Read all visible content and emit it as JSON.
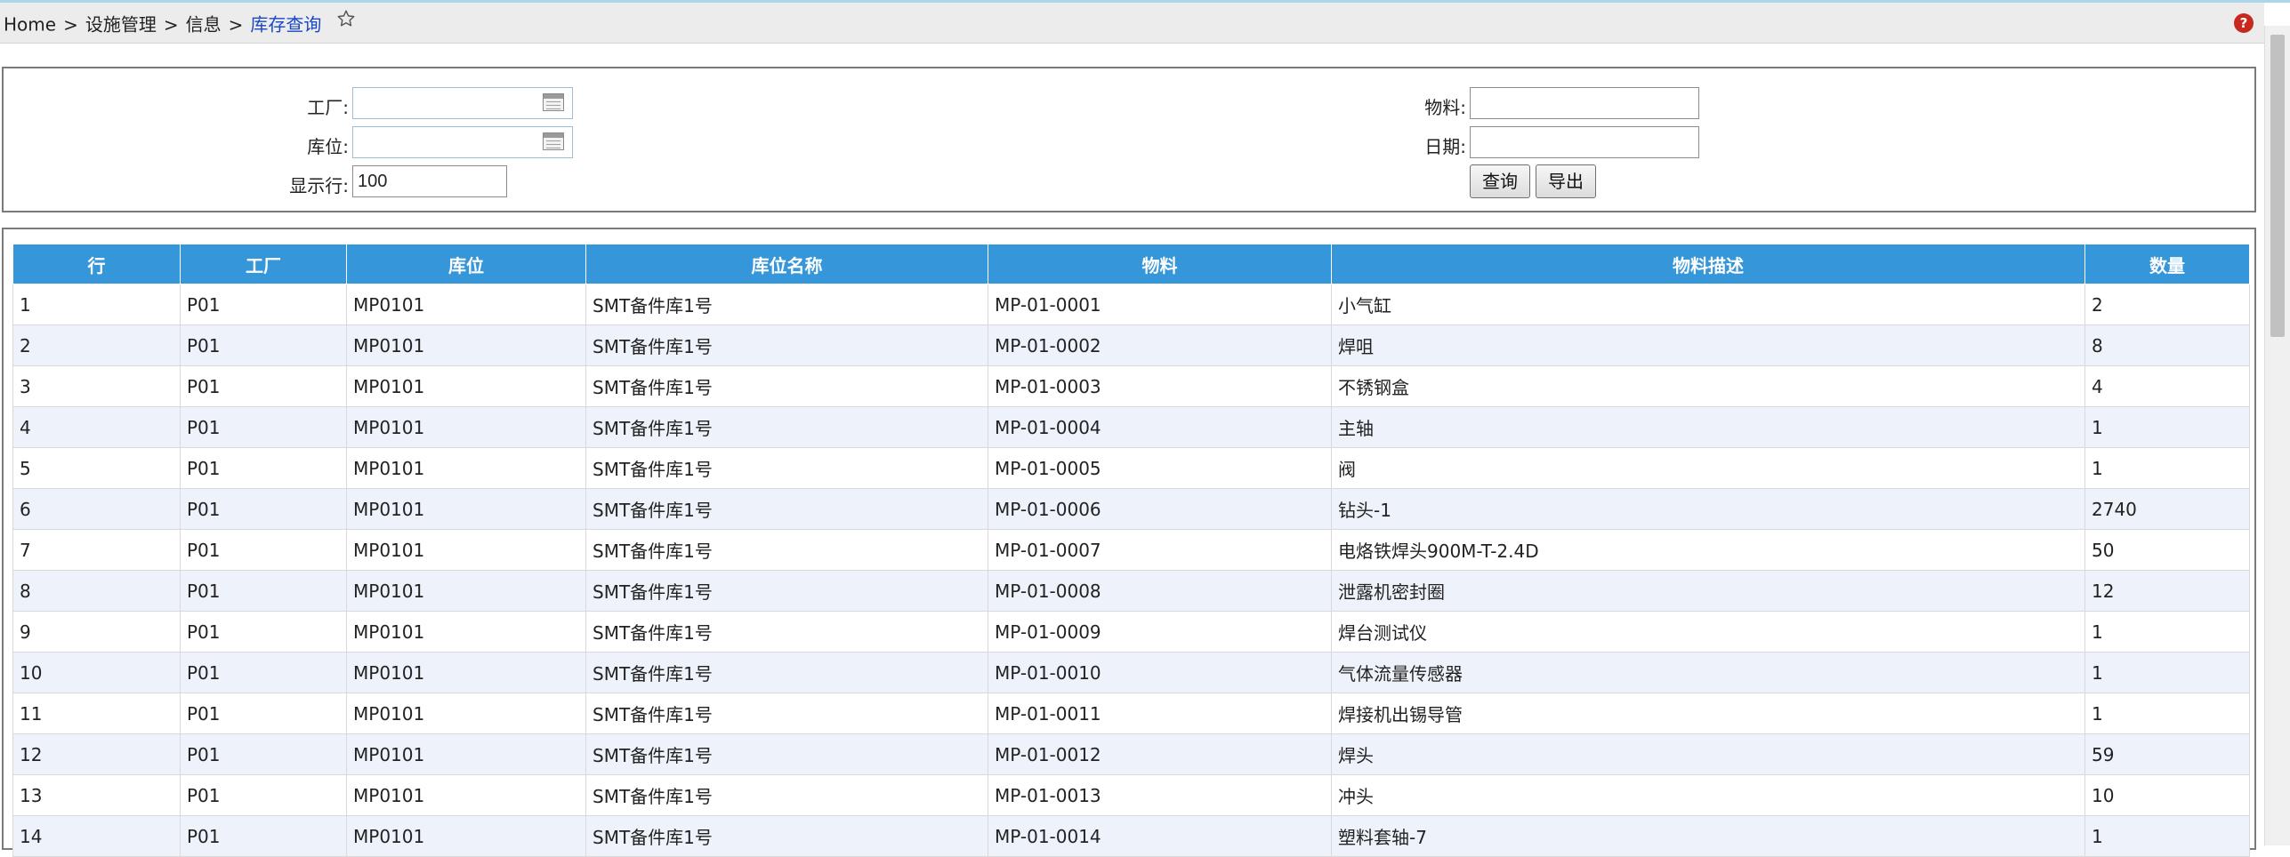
{
  "breadcrumb": {
    "home": "Home",
    "sep": ">",
    "level1": "设施管理",
    "level2": "信息",
    "current": "库存查询"
  },
  "icons": {
    "favorite": "star-outline-icon",
    "help": "help-icon",
    "calendar": "calendar-icon"
  },
  "help_label": "?",
  "form": {
    "plant_label": "工厂:",
    "plant_value": "",
    "location_label": "库位:",
    "location_value": "",
    "rows_label": "显示行:",
    "rows_value": "100",
    "material_label": "物料:",
    "material_value": "",
    "date_label": "日期:",
    "date_value": "",
    "query_button": "查询",
    "export_button": "导出"
  },
  "colors": {
    "header_bg": "#3596d9",
    "row_alt": "#eef3fb",
    "breadcrumb_current": "#1a46c8"
  },
  "table": {
    "columns": [
      "行",
      "工厂",
      "库位",
      "库位名称",
      "物料",
      "物料描述",
      "数量"
    ],
    "rows": [
      [
        "1",
        "P01",
        "MP0101",
        "SMT备件库1号",
        "MP-01-0001",
        "小气缸",
        "2"
      ],
      [
        "2",
        "P01",
        "MP0101",
        "SMT备件库1号",
        "MP-01-0002",
        "焊咀",
        "8"
      ],
      [
        "3",
        "P01",
        "MP0101",
        "SMT备件库1号",
        "MP-01-0003",
        "不锈钢盒",
        "4"
      ],
      [
        "4",
        "P01",
        "MP0101",
        "SMT备件库1号",
        "MP-01-0004",
        "主轴",
        "1"
      ],
      [
        "5",
        "P01",
        "MP0101",
        "SMT备件库1号",
        "MP-01-0005",
        "阀",
        "1"
      ],
      [
        "6",
        "P01",
        "MP0101",
        "SMT备件库1号",
        "MP-01-0006",
        "钻头-1",
        "2740"
      ],
      [
        "7",
        "P01",
        "MP0101",
        "SMT备件库1号",
        "MP-01-0007",
        "电烙铁焊头900M-T-2.4D",
        "50"
      ],
      [
        "8",
        "P01",
        "MP0101",
        "SMT备件库1号",
        "MP-01-0008",
        "泄露机密封圈",
        "12"
      ],
      [
        "9",
        "P01",
        "MP0101",
        "SMT备件库1号",
        "MP-01-0009",
        "焊台测试仪",
        "1"
      ],
      [
        "10",
        "P01",
        "MP0101",
        "SMT备件库1号",
        "MP-01-0010",
        "气体流量传感器",
        "1"
      ],
      [
        "11",
        "P01",
        "MP0101",
        "SMT备件库1号",
        "MP-01-0011",
        "焊接机出锡导管",
        "1"
      ],
      [
        "12",
        "P01",
        "MP0101",
        "SMT备件库1号",
        "MP-01-0012",
        "焊头",
        "59"
      ],
      [
        "13",
        "P01",
        "MP0101",
        "SMT备件库1号",
        "MP-01-0013",
        "冲头",
        "10"
      ],
      [
        "14",
        "P01",
        "MP0101",
        "SMT备件库1号",
        "MP-01-0014",
        "塑料套轴-7",
        "1"
      ]
    ]
  }
}
